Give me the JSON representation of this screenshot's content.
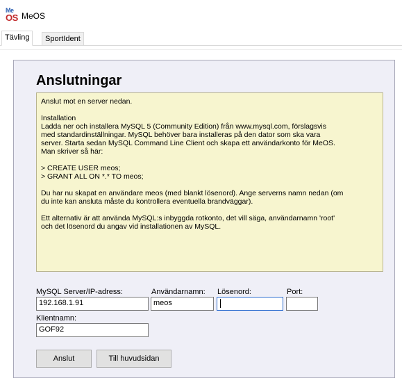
{
  "window": {
    "logo_top": "Me",
    "logo_bottom": "OS",
    "title": "MeOS"
  },
  "tabs": [
    {
      "label": "Tävling",
      "active": true
    },
    {
      "label": "SportIdent",
      "active": false
    }
  ],
  "page": {
    "heading": "Anslutningar"
  },
  "info": {
    "intro": "Anslut mot en server nedan.",
    "install_title": "Installation",
    "install_lines": [
      "Ladda ner och installera MySQL 5 (Community Edition) från www.mysql.com, förslagsvis",
      "med standardinställningar. MySQL behöver bara installeras på den dator som ska vara",
      "server. Starta sedan MySQL Command Line Client och skapa ett användarkonto för MeOS.",
      "Man skriver så här:"
    ],
    "cmd_lines": [
      "> CREATE USER meos;",
      "> GRANT ALL ON *.* TO meos;"
    ],
    "created_lines": [
      "Du har nu skapat en användare meos (med blankt lösenord). Ange serverns namn nedan (om",
      "du inte kan ansluta måste du kontrollera eventuella brandväggar)."
    ],
    "alt_lines": [
      "Ett alternativ är att använda MySQL:s inbyggda rotkonto, det vill säga, användarnamn 'root'",
      "och det lösenord du angav vid installationen av MySQL."
    ]
  },
  "form": {
    "server_label": "MySQL Server/IP-adress:",
    "server_value": "192.168.1.91",
    "user_label": "Användarnamn:",
    "user_value": "meos",
    "password_label": "Lösenord:",
    "password_value": "",
    "port_label": "Port:",
    "port_value": "",
    "client_label": "Klientnamn:",
    "client_value": "GOF92"
  },
  "buttons": {
    "connect": "Anslut",
    "home": "Till huvudsidan"
  }
}
